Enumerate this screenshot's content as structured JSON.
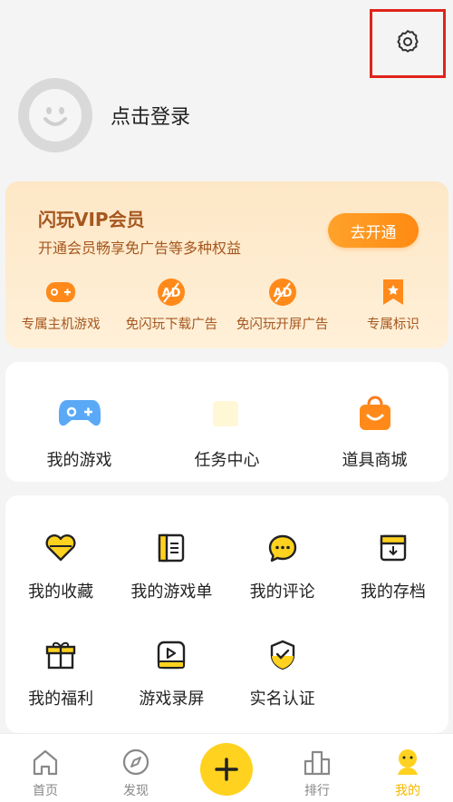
{
  "profile": {
    "login_text": "点击登录"
  },
  "vip": {
    "title": "闪玩VIP会员",
    "subtitle": "开通会员畅享免广告等多种权益",
    "cta": "去开通",
    "perks": [
      {
        "icon": "gamepad-icon",
        "label": "专属主机游戏"
      },
      {
        "icon": "no-ad-icon",
        "label": "免闪玩下载广告"
      },
      {
        "icon": "no-ad-icon",
        "label": "免闪玩开屏广告"
      },
      {
        "icon": "bookmark-star-icon",
        "label": "专属标识"
      }
    ]
  },
  "quick": [
    {
      "icon": "gamepad-icon",
      "label": "我的游戏"
    },
    {
      "icon": "task-icon",
      "label": "任务中心"
    },
    {
      "icon": "shopping-bag-icon",
      "label": "道具商城"
    }
  ],
  "grid": [
    {
      "icon": "heart-icon",
      "label": "我的收藏"
    },
    {
      "icon": "list-icon",
      "label": "我的游戏单"
    },
    {
      "icon": "comment-icon",
      "label": "我的评论"
    },
    {
      "icon": "archive-icon",
      "label": "我的存档"
    },
    {
      "icon": "gift-icon",
      "label": "我的福利"
    },
    {
      "icon": "record-icon",
      "label": "游戏录屏"
    },
    {
      "icon": "shield-check-icon",
      "label": "实名认证"
    }
  ],
  "tabs": [
    {
      "icon": "home-icon",
      "label": "首页"
    },
    {
      "icon": "compass-icon",
      "label": "发现"
    },
    {
      "icon": "plus-icon",
      "label": ""
    },
    {
      "icon": "ranking-icon",
      "label": "排行"
    },
    {
      "icon": "mine-icon",
      "label": "我的"
    }
  ],
  "colors": {
    "accent": "#ffd21f",
    "vip_text": "#a5571f",
    "vip_button": "#ff9a1f",
    "highlight_border": "#e0231b"
  }
}
